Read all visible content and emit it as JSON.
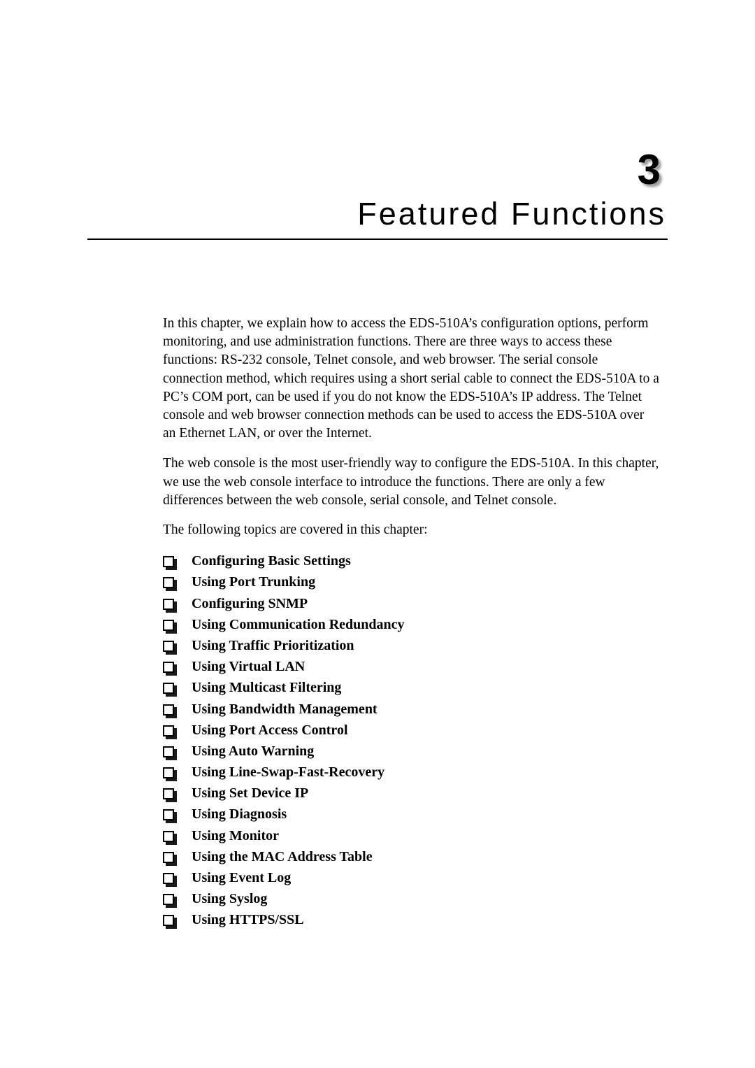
{
  "document": {
    "chapter_number": "3",
    "chapter_title": "Featured Functions"
  },
  "body": {
    "paragraph_1": "In this chapter, we explain how to access the EDS-510A’s configuration options, perform monitoring, and use administration functions. There are three ways to access these functions: RS-232 console, Telnet console, and web browser. The serial console connection method, which requires using a short serial cable to connect the EDS-510A to a PC’s COM port, can be used if you do not know the EDS-510A’s IP address. The Telnet console and web browser connection methods can be used to access the EDS-510A over an Ethernet LAN, or over the Internet.",
    "paragraph_2": "The web console is the most user-friendly way to configure the EDS-510A. In this chapter, we use the web console interface to introduce the functions. There are only a few differences between the web console, serial console, and Telnet console.",
    "paragraph_3": "The following topics are covered in this chapter:"
  },
  "topics": {
    "bullet_icon": "hollow-square-bullet-icon",
    "items": [
      {
        "label": "Configuring Basic Settings"
      },
      {
        "label": "Using Port Trunking"
      },
      {
        "label": "Configuring SNMP"
      },
      {
        "label": "Using Communication Redundancy"
      },
      {
        "label": "Using Traffic Prioritization"
      },
      {
        "label": "Using Virtual LAN"
      },
      {
        "label": "Using Multicast Filtering"
      },
      {
        "label": "Using Bandwidth Management"
      },
      {
        "label": "Using Port Access Control"
      },
      {
        "label": "Using Auto Warning"
      },
      {
        "label": "Using Line-Swap-Fast-Recovery"
      },
      {
        "label": "Using Set Device IP"
      },
      {
        "label": "Using Diagnosis"
      },
      {
        "label": "Using Monitor"
      },
      {
        "label": "Using the MAC Address Table"
      },
      {
        "label": "Using Event Log"
      },
      {
        "label": "Using Syslog"
      },
      {
        "label": "Using HTTPS/SSL"
      }
    ]
  },
  "colors": {
    "page_background": "#ffffff",
    "text": "#000000",
    "rule": "#000000",
    "number_shadow": "#7d7d7d"
  }
}
